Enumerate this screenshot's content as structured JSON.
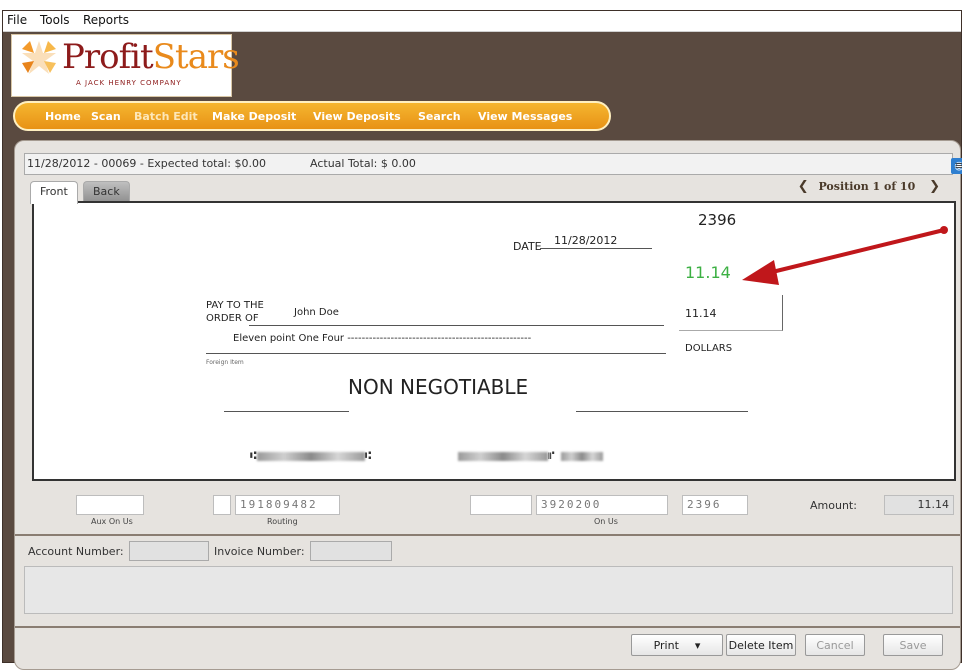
{
  "menu": {
    "file": "File",
    "tools": "Tools",
    "reports": "Reports"
  },
  "logo": {
    "word_main": "Profit",
    "word_accent": "Stars",
    "tagline": "A JACK HENRY COMPANY"
  },
  "nav": {
    "home": "Home",
    "scan": "Scan",
    "batch_edit": "Batch Edit",
    "make_deposit": "Make Deposit",
    "view_deposits": "View Deposits",
    "search": "Search",
    "view_messages": "View Messages"
  },
  "status": {
    "batch": "11/28/2012 - 00069 - Expected total: $0.00",
    "actual": "Actual Total: $ 0.00"
  },
  "tabs": {
    "front": "Front",
    "back": "Back"
  },
  "position": {
    "text": "Position 1 of 10"
  },
  "check": {
    "number": "2396",
    "date_label": "DATE",
    "date_value": "11/28/2012",
    "annotation_amount": "11.14",
    "pay_to_line1": "PAY TO THE",
    "pay_to_line2": "ORDER OF",
    "payee": "John Doe",
    "amount_box": "11.14",
    "written_amount": "Eleven point One Four ---------------------------------------------------",
    "dollars": "DOLLARS",
    "foreign_item": "Foreign Item",
    "stamp": "NON NEGOTIABLE"
  },
  "fields": {
    "routing_value": "191809482",
    "onus_value": "3920200",
    "check_no_value": "2396",
    "aux_on_us_label": "Aux On Us",
    "routing_label": "Routing",
    "on_us_label": "On Us",
    "amount_label": "Amount:",
    "amount_value": "11.14"
  },
  "account": {
    "account_label": "Account Number:",
    "invoice_label": "Invoice Number:"
  },
  "buttons": {
    "print": "Print",
    "delete": "Delete Item",
    "cancel": "Cancel",
    "save": "Save"
  },
  "colors": {
    "annotation_green": "#3cb043",
    "arrow_red": "#c0171b",
    "nav_orange": "#f0a020",
    "frame_brown": "#5a4a40"
  }
}
